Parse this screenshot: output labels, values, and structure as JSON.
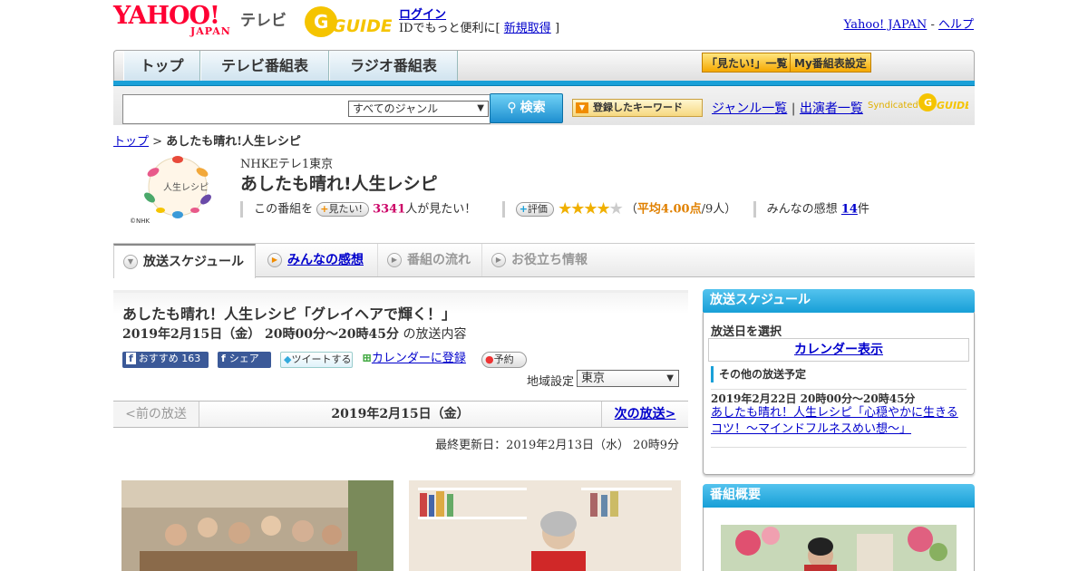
{
  "header": {
    "logo_yahoo": "YAHOO!",
    "logo_japan": "JAPAN",
    "logo_tv": "テレビ",
    "gguide": "GUIDE",
    "login": "ログイン",
    "login_sub_prefix": "IDでもっと便利に[",
    "signup": "新規取得",
    "login_sub_suffix": "]",
    "yahoo_japan": "Yahoo! JAPAN",
    "sep": "-",
    "help": "ヘルプ"
  },
  "nav": {
    "tabs": [
      "トップ",
      "テレビ番組表",
      "ラジオ番組表"
    ],
    "want_list": "「見たい!」一覧",
    "my_schedule": "My番組表設定"
  },
  "search": {
    "placeholder": "",
    "genre": "すべてのジャンル",
    "button": "検索",
    "keyword_button": "登録したキーワード",
    "genre_list": "ジャンル一覧",
    "divider": "|",
    "performer_list": "出演者一覧",
    "syndicated": "Syndicated"
  },
  "breadcrumb": {
    "top": "トップ",
    "sep": ">",
    "current": "あしたも晴れ!人生レシピ"
  },
  "program": {
    "image_caption": "©NHK",
    "image_title": "人生レシピ",
    "channel": "NHKEテレ1東京",
    "title": "あしたも晴れ!人生レシピ",
    "want_prefix": "この番組を",
    "want_button": "見たい!",
    "want_count": "3341",
    "want_suffix": "人が見たい！",
    "rate_button": "評価",
    "rating": 4,
    "avg_open": "（",
    "avg_label": "平均4.00点",
    "avg_votes": "/9人）",
    "impressions_label": "みんなの感想",
    "impressions_count": "14",
    "impressions_suffix": "件"
  },
  "section_tabs": [
    "放送スケジュール",
    "みんなの感想",
    "番組の流れ",
    "お役立ち情報"
  ],
  "episode": {
    "title": "あしたも晴れ！人生レシピ「グレイヘアで輝く！」",
    "date": "2019年2月15日（金） 20時00分～20時45分",
    "date_suffix": "の放送内容",
    "recommend": "おすすめ",
    "recommend_count": "163",
    "share": "シェア",
    "tweet": "ツイートする",
    "calendar": "カレンダーに登録",
    "reserve": "予約",
    "region_label": "地域設定",
    "region": "東京",
    "prev": "<前の放送",
    "current_date": "2019年2月15日（金）",
    "next": "次の放送>",
    "last_updated": "最終更新日：2019年2月13日（水） 20時9分"
  },
  "sidebar": {
    "schedule_heading": "放送スケジュール",
    "date_select": "放送日を選択",
    "calendar_link": "カレンダー表示",
    "other_label": "その他の放送予定",
    "other_date": "2019年2月22日 20時00分～20時45分",
    "other_title": "あしたも晴れ！人生レシピ「心穏やかに生きるコツ！～マインドフルネスめい想～」",
    "overview_heading": "番組概要"
  },
  "colors": {
    "accent_blue": "#1aa0d8",
    "brand_red": "#ff0033",
    "gguide_yellow": "#f5c400",
    "link": "#0000cc",
    "pink_count": "#cc0066",
    "avg_orange": "#e08000"
  }
}
